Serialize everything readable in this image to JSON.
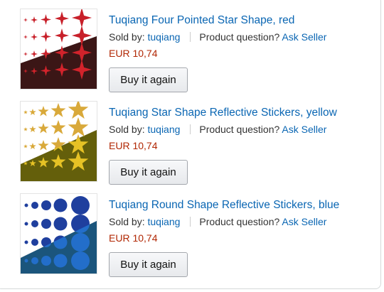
{
  "orders": [
    {
      "title": "Tuqiang Four Pointed Star Shape, red",
      "sold_by_label": "Sold by:",
      "seller": "tuqiang",
      "question_label": "Product question?",
      "ask_seller": "Ask Seller",
      "price": "EUR 10,74",
      "button": "Buy it again",
      "thumb_icon": "red-four-pointed-star-stickers-image",
      "color": "#c8202a"
    },
    {
      "title": "Tuqiang Star Shape Reflective Stickers, yellow",
      "sold_by_label": "Sold by:",
      "seller": "tuqiang",
      "question_label": "Product question?",
      "ask_seller": "Ask Seller",
      "price": "EUR 10,74",
      "button": "Buy it again",
      "thumb_icon": "yellow-star-stickers-image",
      "color": "#d4a830"
    },
    {
      "title": "Tuqiang Round Shape Reflective Stickers, blue",
      "sold_by_label": "Sold by:",
      "seller": "tuqiang",
      "question_label": "Product question?",
      "ask_seller": "Ask Seller",
      "price": "EUR 10,74",
      "button": "Buy it again",
      "thumb_icon": "blue-round-stickers-image",
      "color": "#1f3f9e"
    }
  ],
  "colors": {
    "link": "#0a66b3",
    "price": "#b12704"
  }
}
